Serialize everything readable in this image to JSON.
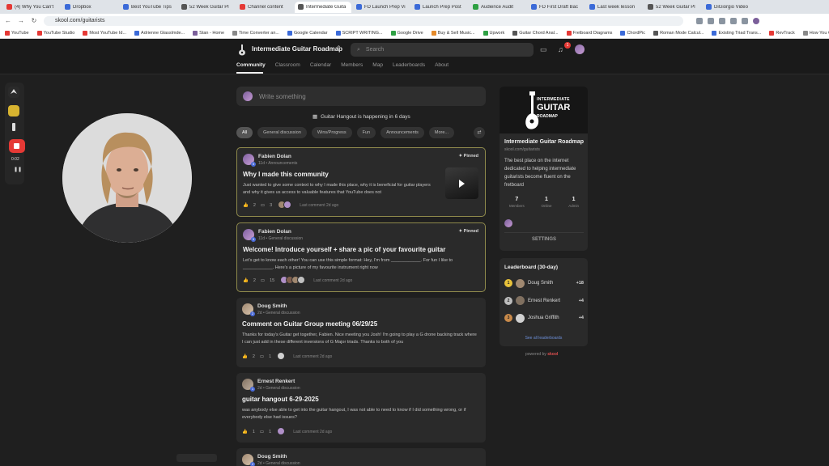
{
  "browser": {
    "tabs": [
      {
        "title": "(4) Why You Can't",
        "color": "#e53935"
      },
      {
        "title": "Dropbox",
        "color": "#3b6ad8"
      },
      {
        "title": "Best YouTube Tips",
        "color": "#3b6ad8"
      },
      {
        "title": "52 Week Guitar Pl",
        "color": "#555555"
      },
      {
        "title": "Channel content",
        "color": "#e53935"
      },
      {
        "title": "Intermediate Guita",
        "color": "#555555",
        "active": true
      },
      {
        "title": "FD Launch Prep Vi",
        "color": "#3b6ad8"
      },
      {
        "title": "Launch Prep Post",
        "color": "#3b6ad8"
      },
      {
        "title": "Audience Audit",
        "color": "#2ea043"
      },
      {
        "title": "FD First Draft Bac",
        "color": "#3b6ad8"
      },
      {
        "title": "Last week lesson",
        "color": "#3b6ad8"
      },
      {
        "title": "52 Week Guitar Pl",
        "color": "#555555"
      },
      {
        "title": "DiGiorgio Video",
        "color": "#3b6ad8"
      }
    ],
    "url": "skool.com/guitarists",
    "bookmarks": [
      {
        "label": "YouTube",
        "color": "#e53935"
      },
      {
        "label": "YouTube Studio",
        "color": "#e53935"
      },
      {
        "label": "Most YouTube Id...",
        "color": "#e53935"
      },
      {
        "label": "Adrienne Glasslmde...",
        "color": "#3b6ad8"
      },
      {
        "label": "Stan - Home",
        "color": "#7b5f9a"
      },
      {
        "label": "Time Converter an...",
        "color": "#888888"
      },
      {
        "label": "Google Calendar",
        "color": "#3b6ad8"
      },
      {
        "label": "SCRIPT WRITING...",
        "color": "#3b6ad8"
      },
      {
        "label": "Google Drive",
        "color": "#2ea043"
      },
      {
        "label": "Buy & Sell Music...",
        "color": "#e58a2a"
      },
      {
        "label": "Upwork",
        "color": "#2ea043"
      },
      {
        "label": "Guitar Chord Anal...",
        "color": "#555555"
      },
      {
        "label": "Fretboard Diagrams",
        "color": "#e53935"
      },
      {
        "label": "ChordPic",
        "color": "#3b6ad8"
      },
      {
        "label": "Roman Mode Calcul...",
        "color": "#555555"
      },
      {
        "label": "Existing Triad Trans...",
        "color": "#3b6ad8"
      },
      {
        "label": "RevTrack",
        "color": "#e53935"
      },
      {
        "label": "How You Got Goo...",
        "color": "#888888"
      }
    ]
  },
  "header": {
    "group_name": "Intermediate Guitar Roadmap",
    "search_placeholder": "Search",
    "notif_count": "1",
    "nav": [
      "Community",
      "Classroom",
      "Calendar",
      "Members",
      "Map",
      "Leaderboards",
      "About"
    ]
  },
  "recorder": {
    "time": "0:02"
  },
  "feed": {
    "composer_placeholder": "Write something",
    "event_text": "Guitar Hangout is happening in 6 days",
    "filters": [
      "All",
      "General discussion",
      "Wins/Progress",
      "Fun",
      "Announcements",
      "More..."
    ],
    "posts": [
      {
        "author": "Fabien Dolan",
        "level": "5",
        "meta": "11d • Announcements",
        "pinned": "Pinned",
        "title": "Why I made this community",
        "body": "Just wanted to give some context to why I made this place, why it is beneficial for guitar players and why it gives us access to valuable features that YouTube does not",
        "likes": "2",
        "comments": "3",
        "last": "Last comment 2d ago"
      },
      {
        "author": "Fabien Dolan",
        "level": "5",
        "meta": "11d • General discussion",
        "pinned": "Pinned",
        "title": "Welcome! Introduce yourself + share a pic of your favourite guitar",
        "body": "Let's get to know each other! You can use this simple format: Hey, I'm from ____________. For fun I like to ____________. Here's a picture of my favourite instrument right now",
        "likes": "2",
        "comments": "15",
        "last": "Last comment 2d ago"
      },
      {
        "author": "Doug Smith",
        "level": "2",
        "meta": "2d • General discussion",
        "title": "Comment on Guitar Group meeting 06/29/25",
        "body": "Thanks for today's Guitar get together, Fabien. Nice meeting you Josh! I'm going to play a G drone backing track where I can just add in these different inversions of G Major triads. Thanks to both of you",
        "likes": "2",
        "comments": "1",
        "last": "Last comment 2d ago"
      },
      {
        "author": "Ernest Renkert",
        "level": "1",
        "meta": "2d • General discussion",
        "title": "guitar hangout 6-29-2025",
        "body": "was anybody else able to get into the guitar hangout, I was not able to need to know if I did something wrong, or if everybody else had issues?",
        "likes": "1",
        "comments": "1",
        "last": "Last comment 2d ago"
      },
      {
        "author": "Doug Smith",
        "level": "2",
        "meta": "2d • General discussion"
      }
    ]
  },
  "sidebar": {
    "banner_t1": "INTERMEDIATE",
    "banner_t2": "GUITAR",
    "banner_t3": "ROADMAP",
    "title": "Intermediate Guitar Roadmap",
    "url": "skool.com/guitarists",
    "description": "The best place on the internet dedicated to helping intermediate guitarists become fluent on the fretboard",
    "stats": [
      {
        "value": "7",
        "label": "Members"
      },
      {
        "value": "1",
        "label": "Online"
      },
      {
        "value": "1",
        "label": "Admin"
      }
    ],
    "settings_label": "SETTINGS"
  },
  "leaderboard": {
    "title": "Leaderboard (30-day)",
    "rows": [
      {
        "rank": "1",
        "name": "Doug Smith",
        "points": "+18",
        "medal": "#e8c23a"
      },
      {
        "rank": "2",
        "name": "Ernest Renkert",
        "points": "+4",
        "medal": "#bdbdbd"
      },
      {
        "rank": "3",
        "name": "Joshua Griffith",
        "points": "+4",
        "medal": "#c98a4a"
      }
    ],
    "link": "See all leaderboards"
  },
  "footer": {
    "powered_prefix": "powered by",
    "powered_brand": "skool"
  }
}
